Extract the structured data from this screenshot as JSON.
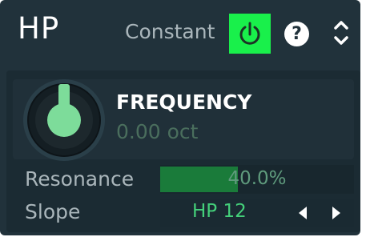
{
  "header": {
    "title": "HP",
    "mode_label": "Constant",
    "help_label": "?"
  },
  "frequency": {
    "name": "FREQUENCY",
    "value": "0.00 oct"
  },
  "resonance": {
    "label": "Resonance",
    "value": "40.0%",
    "level": 0.4
  },
  "slope": {
    "label": "Slope",
    "value": "HP 12"
  },
  "colors": {
    "panel": "#21323b",
    "power_on": "#19f04b",
    "knob_indicator": "#7ddc9a",
    "slider_fill": "#1a7b3a",
    "slope_text": "#44d07a"
  },
  "icons": {
    "power": "power-icon",
    "help": "help-icon",
    "expand": "up-down-chevron-icon",
    "prev": "triangle-left-icon",
    "next": "triangle-right-icon"
  }
}
